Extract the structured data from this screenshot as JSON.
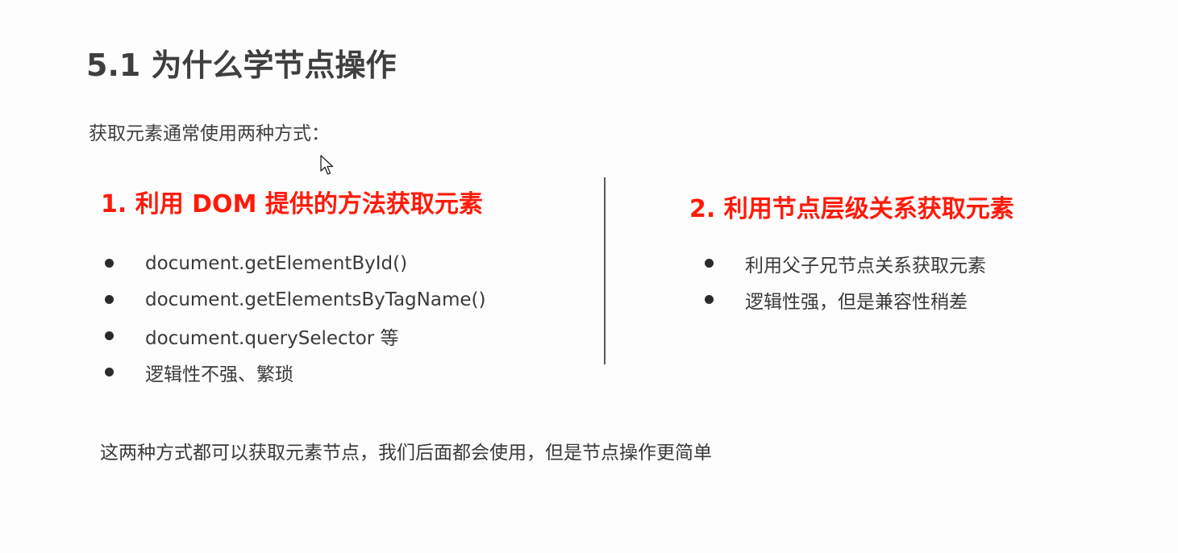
{
  "slide": {
    "title": "5.1 为什么学节点操作",
    "intro": "获取元素通常使用两种方式：",
    "left_column": {
      "heading": "1. 利用 DOM 提供的方法获取元素",
      "items": [
        "document.getElementById()",
        "document.getElementsByTagName()",
        "document.querySelector 等",
        "逻辑性不强、繁琐"
      ]
    },
    "right_column": {
      "heading": "2. 利用节点层级关系获取元素",
      "items": [
        "利用父子兄节点关系获取元素",
        "逻辑性强，但是兼容性稍差"
      ]
    },
    "summary": "这两种方式都可以获取元素节点，我们后面都会使用，但是节点操作更简单"
  },
  "colors": {
    "title": "#3f3f3f",
    "heading_accent": "#ff1a0a",
    "body_text": "#3a3a3a",
    "divider": "#5a5a5a"
  },
  "icons": {
    "cursor": "mouse-pointer-icon",
    "bullet": "bullet-dot-icon"
  }
}
